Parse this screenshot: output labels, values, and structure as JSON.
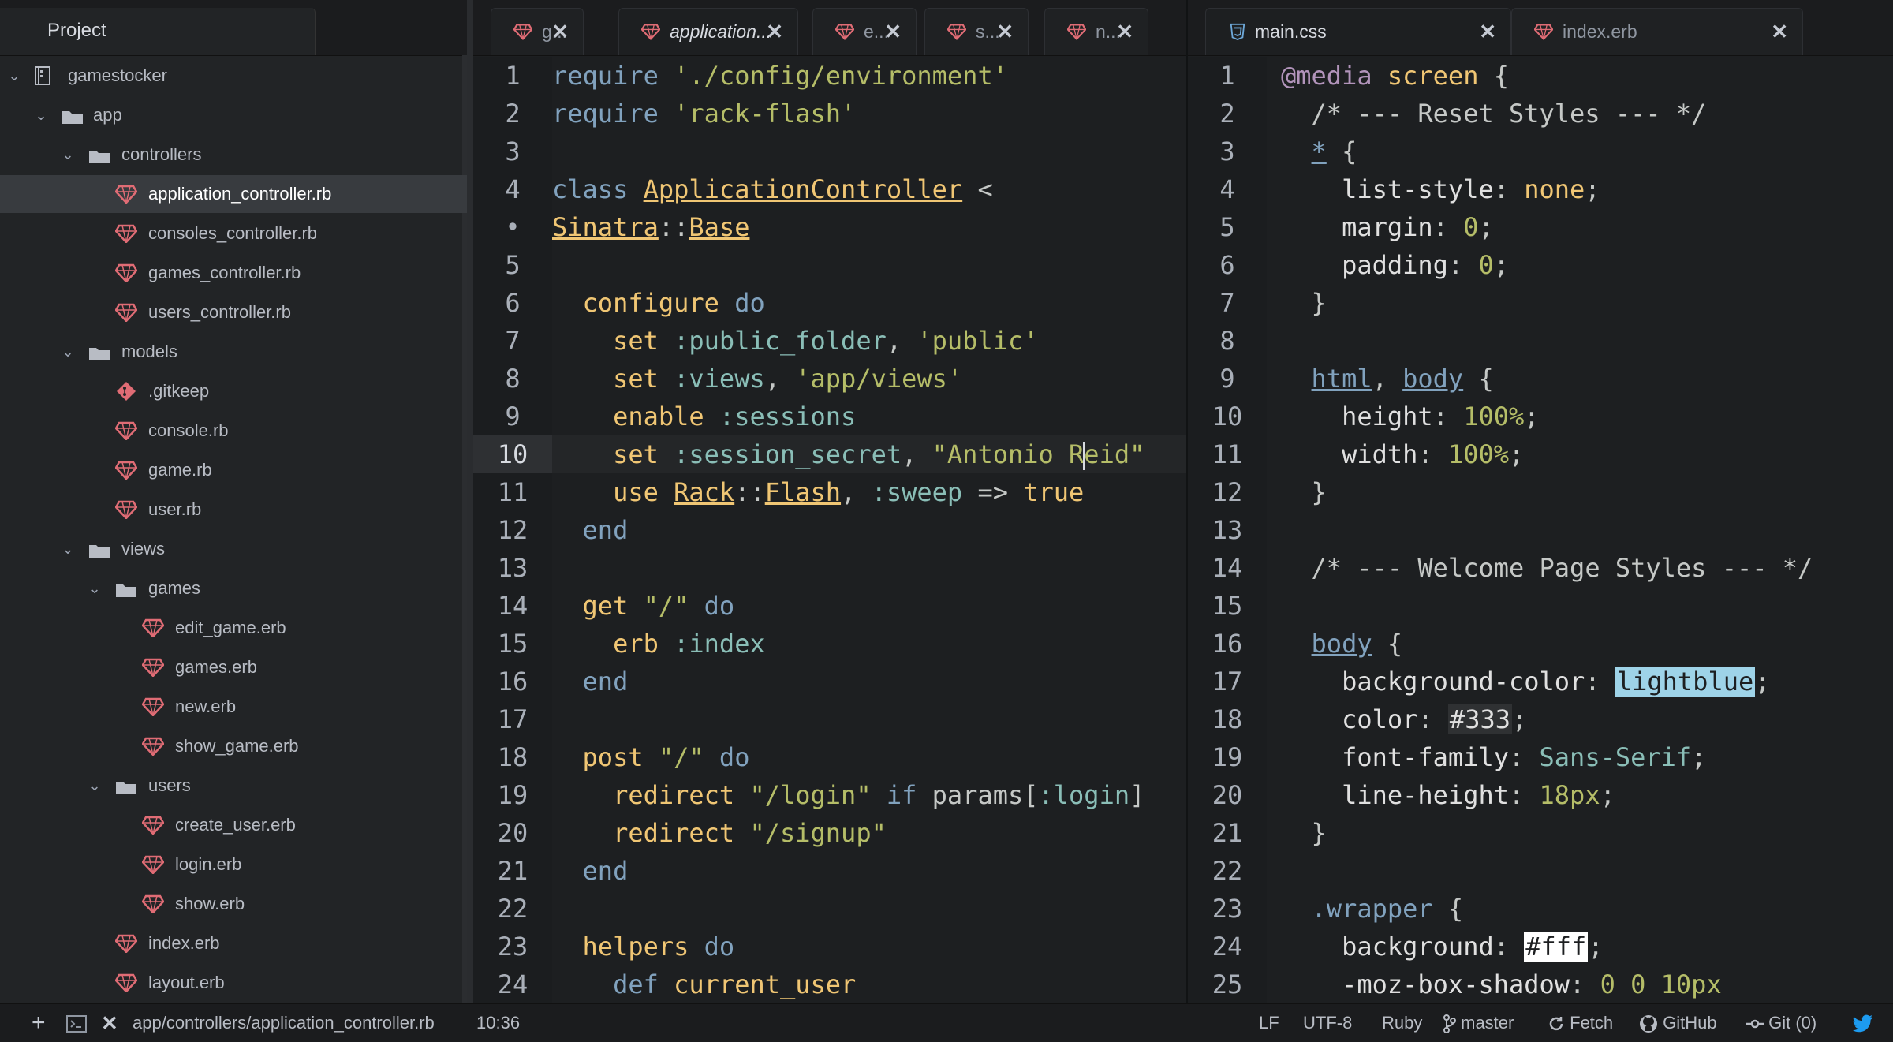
{
  "tree": {
    "header": "Project",
    "root": "gamestocker",
    "app": "app",
    "controllers": "controllers",
    "application_controller": "application_controller.rb",
    "consoles_controller": "consoles_controller.rb",
    "games_controller": "games_controller.rb",
    "users_controller": "users_controller.rb",
    "models": "models",
    "gitkeep": ".gitkeep",
    "console_rb": "console.rb",
    "game_rb": "game.rb",
    "user_rb": "user.rb",
    "views": "views",
    "games": "games",
    "edit_game": "edit_game.erb",
    "games_erb": "games.erb",
    "new_erb": "new.erb",
    "show_game": "show_game.erb",
    "users": "users",
    "create_user": "create_user.erb",
    "login_erb": "login.erb",
    "show_erb": "show.erb",
    "index_erb": "index.erb",
    "layout_erb": "layout.erb"
  },
  "left_tabs": [
    "g...",
    "application...",
    "e...",
    "s...",
    "n..."
  ],
  "right_tabs": [
    "main.css",
    "index.erb"
  ],
  "close_glyph": "✕",
  "ruby": {
    "nums": [
      "1",
      "2",
      "3",
      "4",
      "•",
      "5",
      "6",
      "7",
      "8",
      "9",
      "10",
      "11",
      "12",
      "13",
      "14",
      "15",
      "16",
      "17",
      "18",
      "19",
      "20",
      "21",
      "22",
      "23",
      "24"
    ],
    "l1a": "require ",
    "l1b": "'./config/environment'",
    "l2a": "require ",
    "l2b": "'rack-flash'",
    "l4a": "class ",
    "l4b": "ApplicationController",
    "l4c": " <",
    "l5a": "Sinatra",
    "l5b": "::",
    "l5c": "Base",
    "l6a": "  configure ",
    "l6b": "do",
    "l7a": "    set ",
    "l7b": ":public_folder",
    "l7c": ", ",
    "l7d": "'public'",
    "l8a": "    set ",
    "l8b": ":views",
    "l8c": ", ",
    "l8d": "'app/views'",
    "l9a": "    enable ",
    "l9b": ":sessions",
    "l10a": "    set ",
    "l10b": ":session_secret",
    "l10c": ", ",
    "l10d": "\"Antonio R",
    "l10e": "eid\"",
    "l11a": "    use ",
    "l11b": "Rack",
    "l11c": "::",
    "l11d": "Flash",
    "l11e": ", ",
    "l11f": ":sweep",
    "l11g": " => ",
    "l11h": "true",
    "l12a": "  end",
    "l14a": "  get ",
    "l14b": "\"/\"",
    "l14c": " do",
    "l15a": "    erb ",
    "l15b": ":index",
    "l16a": "  end",
    "l18a": "  post ",
    "l18b": "\"/\"",
    "l18c": " do",
    "l19a": "    redirect ",
    "l19b": "\"/login\"",
    "l19c": " if ",
    "l19d": "params[",
    "l19e": ":login",
    "l19f": "]",
    "l20a": "    redirect ",
    "l20b": "\"/signup\"",
    "l21a": "  end",
    "l23a": "  helpers ",
    "l23b": "do",
    "l24a": "    def ",
    "l24b": "current_user"
  },
  "css": {
    "nums": [
      "1",
      "2",
      "3",
      "4",
      "5",
      "6",
      "7",
      "8",
      "9",
      "10",
      "11",
      "12",
      "13",
      "14",
      "15",
      "16",
      "17",
      "18",
      "19",
      "20",
      "21",
      "22",
      "23",
      "24",
      "25"
    ],
    "l1a": "@media",
    "l1b": " screen ",
    "l1c": "{",
    "l2a": "  /* --- Reset Styles --- */",
    "l3a": "  ",
    "l3b": "*",
    "l3c": " {",
    "l4a": "    list-style",
    "l4b": ": ",
    "l4c": "none",
    "l4d": ";",
    "l5a": "    margin",
    "l5b": ": ",
    "l5c": "0",
    "l5d": ";",
    "l6a": "    padding",
    "l6b": ": ",
    "l6c": "0",
    "l6d": ";",
    "l7a": "  }",
    "l9a": "  ",
    "l9b": "html",
    "l9c": ", ",
    "l9d": "body",
    "l9e": " {",
    "l10a": "    height",
    "l10b": ": ",
    "l10c": "100%",
    "l10d": ";",
    "l11a": "    width",
    "l11b": ": ",
    "l11c": "100%",
    "l11d": ";",
    "l12a": "  }",
    "l14a": "  /* --- Welcome Page Styles --- */",
    "l16a": "  ",
    "l16b": "body",
    "l16c": " {",
    "l17a": "    background-color",
    "l17b": ": ",
    "l17c": "lightblue",
    "l17d": ";",
    "l18a": "    color",
    "l18b": ": ",
    "l18c": "#333",
    "l18d": ";",
    "l19a": "    font-family",
    "l19b": ": ",
    "l19c": "Sans-Serif",
    "l19d": ";",
    "l20a": "    line-height",
    "l20b": ": ",
    "l20c": "18px",
    "l20d": ";",
    "l21a": "  }",
    "l23a": "  ",
    "l23b": ".wrapper",
    "l23c": " {",
    "l24a": "    background",
    "l24b": ": ",
    "l24c": "#fff",
    "l24d": ";",
    "l25a": "    -moz-box-shadow",
    "l25b": ": ",
    "l25c": "0 0 10px"
  },
  "status": {
    "path": "app/controllers/application_controller.rb",
    "position": "10:36",
    "line_ending": "LF",
    "encoding": "UTF-8",
    "grammar": "Ruby",
    "branch": "master",
    "fetch": "Fetch",
    "github": "GitHub",
    "git": "Git (0)"
  },
  "colors": {
    "ruby_icon": "#e06c75",
    "css_icon": "#6ea8d8",
    "accent_blue": "#1d9bf0"
  }
}
